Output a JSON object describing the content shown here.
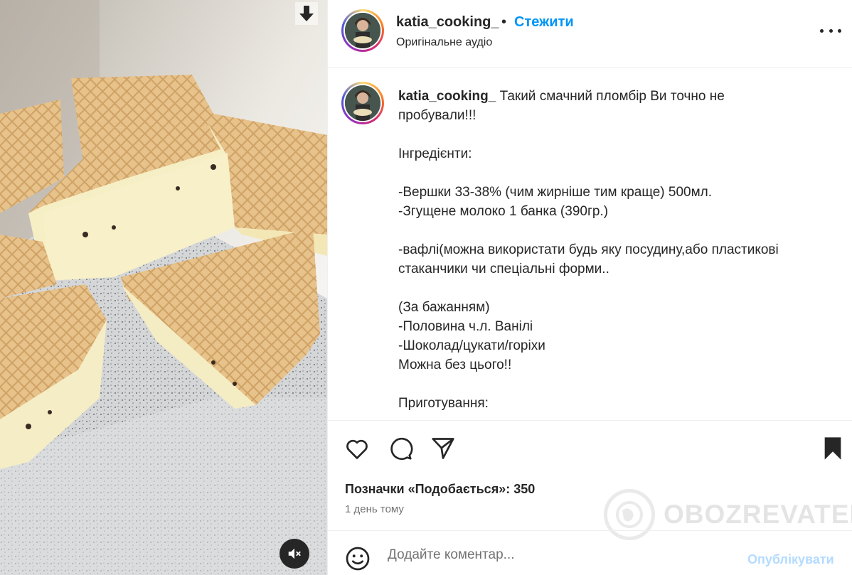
{
  "media": {
    "photo_icon": "ice-cream-wafer-photo",
    "save_icon": "download-arrow-icon",
    "mute_icon": "speaker-muted-icon"
  },
  "header": {
    "username": "katia_cooking_",
    "separator": "•",
    "follow_label": "Стежити",
    "audio_label": "Оригінальне аудіо",
    "more_icon": "more-options-icon"
  },
  "caption": {
    "username": "katia_cooking_",
    "lines": [
      "Такий смачний пломбір Ви точно не",
      "пробували!!!",
      "",
      "Інгредієнти:",
      "",
      "-Вершки 33-38% (чим жирніше тим краще) 500мл.",
      "-Згущене молоко 1 банка (390гр.)",
      "",
      "-вафлі(можна використати будь яку посудину,або пластикові",
      "стаканчики чи спеціальні форми..",
      "",
      "(За бажанням)",
      "-Половина ч.л. Ванілі",
      "-Шоколад/цукати/горіхи",
      "Можна без цього!!",
      "",
      "Приготування:"
    ]
  },
  "actions": {
    "like_icon": "heart-icon",
    "comment_icon": "comment-bubble-icon",
    "share_icon": "send-paper-plane-icon",
    "save_icon": "bookmark-icon",
    "likes_label": "Позначки «Подобається»:",
    "likes_count": "350",
    "time_ago": "1 день тому"
  },
  "watermark": {
    "text": "OBOZREVATEL",
    "icon": "globe-logo-icon"
  },
  "comment": {
    "emoji_icon": "emoji-smile-icon",
    "placeholder": "Додайте коментар...",
    "publish_label": "Опублікувати"
  },
  "colors": {
    "accent": "#0095f6",
    "publish_disabled": "#b3dbff",
    "text": "#262626",
    "muted": "#737373",
    "divider": "#efefef"
  }
}
